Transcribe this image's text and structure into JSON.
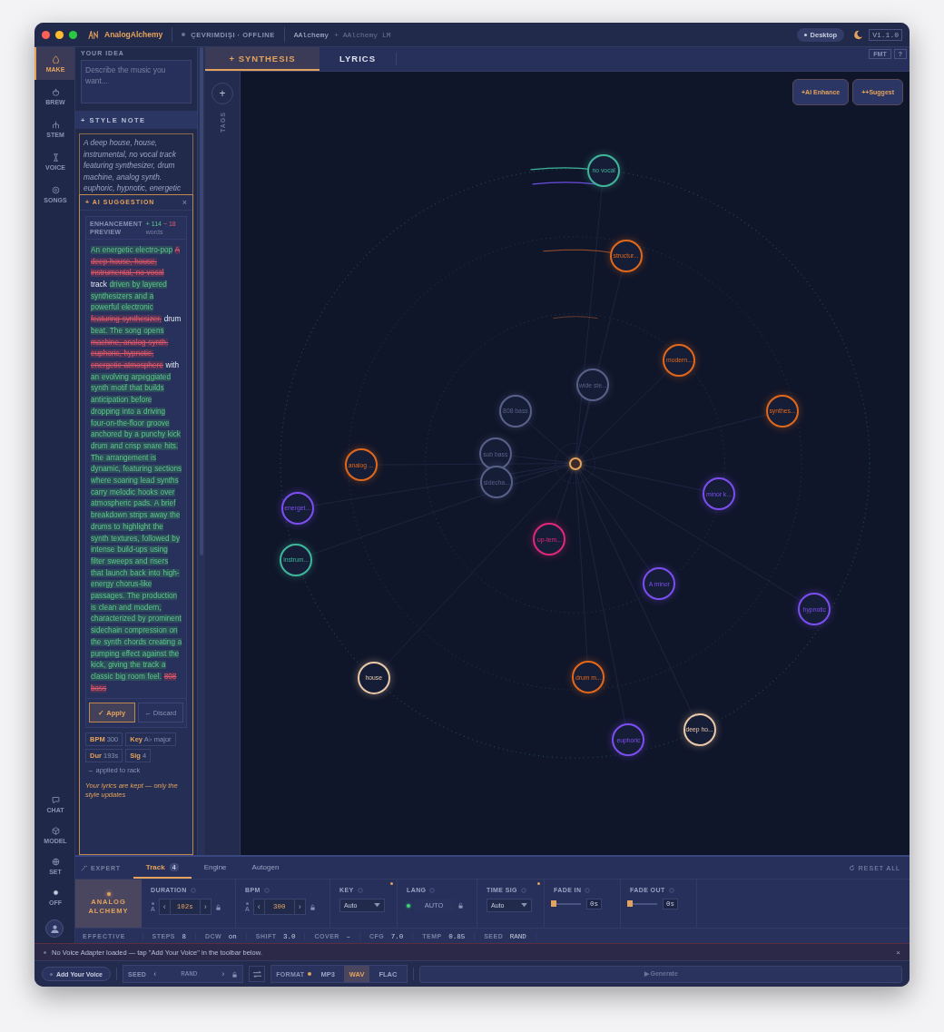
{
  "window": {
    "app_name": "AnalogAlchemy",
    "status": "ÇEVRIMDIŞI · OFFLINE",
    "model": "AAlchemy",
    "model_lm": "+ AAlchemy LM",
    "mode": "Desktop",
    "version": "V1.1.0"
  },
  "nav": {
    "items": [
      {
        "label": "MAKE",
        "kind": "make",
        "selected": true
      },
      {
        "label": "BREW",
        "kind": "brew",
        "selected": false
      },
      {
        "label": "STEM",
        "kind": "stem",
        "selected": false
      },
      {
        "label": "VOICE",
        "kind": "voice",
        "selected": false
      },
      {
        "label": "SONGS",
        "kind": "songs",
        "selected": false
      }
    ],
    "bottom_items": [
      {
        "label": "CHAT",
        "kind": "chat"
      },
      {
        "label": "MODEL",
        "kind": "model"
      },
      {
        "label": "SET",
        "kind": "set"
      },
      {
        "label": "OFF",
        "kind": "off"
      }
    ]
  },
  "idea": {
    "label": "YOUR IDEA",
    "placeholder": "Describe the music you want..."
  },
  "style_note": {
    "title": "+ STYLE NOTE",
    "text": "A deep house, house, instrumental, no vocal track featuring synthesizer, drum machine, analog synth. euphoric, hypnotic, energetic"
  },
  "suggestion": {
    "title": "+ AI SUGGESTION",
    "close": "×",
    "preview_label": "ENHANCEMENT PREVIEW",
    "added_count": "+ 114",
    "removed_count": "− 18",
    "count_unit": "words",
    "diff": [
      {
        "kind": "added",
        "text": "An energetic electro-pop"
      },
      {
        "kind": "removed",
        "text": "A deep house, house, instrumental, no vocal"
      },
      {
        "kind": "same",
        "text": "track"
      },
      {
        "kind": "added",
        "text": "driven by layered synthesizers and a powerful electronic"
      },
      {
        "kind": "removed",
        "text": "featuring synthesizer,"
      },
      {
        "kind": "same",
        "text": "drum"
      },
      {
        "kind": "added",
        "text": "beat. The song opens"
      },
      {
        "kind": "removed",
        "text": "machine, analog synth. euphoric, hypnotic, energetic atmosphere"
      },
      {
        "kind": "same",
        "text": "with"
      },
      {
        "kind": "added",
        "text": "an evolving arpeggiated synth motif that builds anticipation before dropping into a driving four-on-the-floor groove anchored by a punchy kick drum and crisp snare hits. The arrangement is dynamic, featuring sections where soaring lead synths carry melodic hooks over atmospheric pads. A brief breakdown strips away the drums to highlight the synth textures, followed by intense build-ups using filter sweeps and risers that launch back into high-energy chorus-like passages. The production is clean and modern, characterized by prominent sidechain compression on the synth chords creating a pumping effect against the kick, giving the track a classic big room feel."
      },
      {
        "kind": "removed",
        "text": "808 bass"
      }
    ],
    "apply": "✓ Apply",
    "discard": "← Discard",
    "chips": [
      {
        "key": "BPM",
        "value": "300"
      },
      {
        "key": "Key",
        "value": "A♭ major"
      },
      {
        "key": "Dur",
        "value": "193s"
      },
      {
        "key": "Sig",
        "value": "4"
      }
    ],
    "applied_note": "→ applied to rack",
    "lyrics_note": "Your lyrics are kept — only the style updates"
  },
  "tabs": [
    {
      "label": "+ SYNTHESIS",
      "selected": true
    },
    {
      "label": "LYRICS",
      "selected": false
    }
  ],
  "tab_tools": [
    "FMT",
    "?"
  ],
  "tags": {
    "add": "+",
    "label": "TAGS"
  },
  "canvas": {
    "actions": [
      "+AI Enhance",
      "++Suggest"
    ],
    "nodes": [
      {
        "label": "no vocal",
        "color": "#3fb59a"
      },
      {
        "label": "structur...",
        "color": "#e0681c"
      },
      {
        "label": "modern...",
        "color": "#e0681c"
      },
      {
        "label": "wide ste...",
        "color": "#58618a"
      },
      {
        "label": "808 bass",
        "color": "#58618a"
      },
      {
        "label": "synthes...",
        "color": "#e0681c"
      },
      {
        "label": "analog ...",
        "color": "#e0681c"
      },
      {
        "label": "sub bass",
        "color": "#58618a"
      },
      {
        "label": "sidecha...",
        "color": "#58618a"
      },
      {
        "label": "minor k...",
        "color": "#7b4ef0"
      },
      {
        "label": "energet...",
        "color": "#7b4ef0"
      },
      {
        "label": "instrum...",
        "color": "#3fb59a"
      },
      {
        "label": "up-tem...",
        "color": "#e0287a"
      },
      {
        "label": "A minor",
        "color": "#7b4ef0"
      },
      {
        "label": "hypnotic",
        "color": "#7b4ef0"
      },
      {
        "label": "house",
        "color": "#e8c8a8"
      },
      {
        "label": "drum m...",
        "color": "#e0681c"
      },
      {
        "label": "euphoric",
        "color": "#7b4ef0"
      },
      {
        "label": "deep ho...",
        "color": "#e8c8a8"
      }
    ]
  },
  "expert": {
    "label": "EXPERT",
    "tabs": [
      {
        "label": "Track",
        "badge": "4",
        "selected": true
      },
      {
        "label": "Engine",
        "selected": false
      },
      {
        "label": "Autogen",
        "selected": false
      }
    ],
    "reset": "RESET ALL",
    "brand": [
      "ANALOG",
      "ALCHEMY"
    ],
    "params": [
      {
        "kind": "stepper",
        "label": "DURATION",
        "auto": "A",
        "prev": "‹",
        "value": "102s",
        "next": "›",
        "modified": false
      },
      {
        "kind": "stepper",
        "label": "BPM",
        "auto": "A",
        "prev": "‹",
        "value": "300",
        "next": "›",
        "modified": false
      },
      {
        "kind": "select",
        "label": "KEY",
        "value": "Auto",
        "modified": true
      },
      {
        "kind": "locked",
        "label": "LANG",
        "value": "AUTO",
        "active": true,
        "modified": false
      },
      {
        "kind": "select",
        "label": "TIME SIG",
        "value": "Auto",
        "modified": true
      },
      {
        "kind": "fade",
        "label": "FADE IN",
        "level": 0,
        "value": "0s",
        "modified": false
      },
      {
        "kind": "fade",
        "label": "FADE OUT",
        "level": 0,
        "value": "0s",
        "modified": false
      }
    ],
    "effective": {
      "label": "EFFECTIVE",
      "items": [
        {
          "key": "STEPS",
          "value": "8"
        },
        {
          "key": "DCW",
          "value": "on"
        },
        {
          "key": "SHIFT",
          "value": "3.0"
        },
        {
          "key": "COVER",
          "value": "–"
        },
        {
          "key": "CFG",
          "value": "7.0"
        },
        {
          "key": "TEMP",
          "value": "0.85"
        },
        {
          "key": "SEED",
          "value": "RAND"
        }
      ]
    }
  },
  "notice": {
    "text": "No Voice Adapter loaded — tap \"Add Your Voice\" in the toolbar below.",
    "close": "×"
  },
  "toolbar": {
    "add_voice": "Add Your Voice",
    "seed_label": "SEED",
    "seed_prev": "‹",
    "seed_value": "RAND",
    "seed_next": "›",
    "format_label": "FORMAT",
    "formats": [
      {
        "label": "MP3",
        "selected": false
      },
      {
        "label": "WAV",
        "selected": true
      },
      {
        "label": "FLAC",
        "selected": false
      }
    ],
    "generate": "▶ Generate"
  }
}
